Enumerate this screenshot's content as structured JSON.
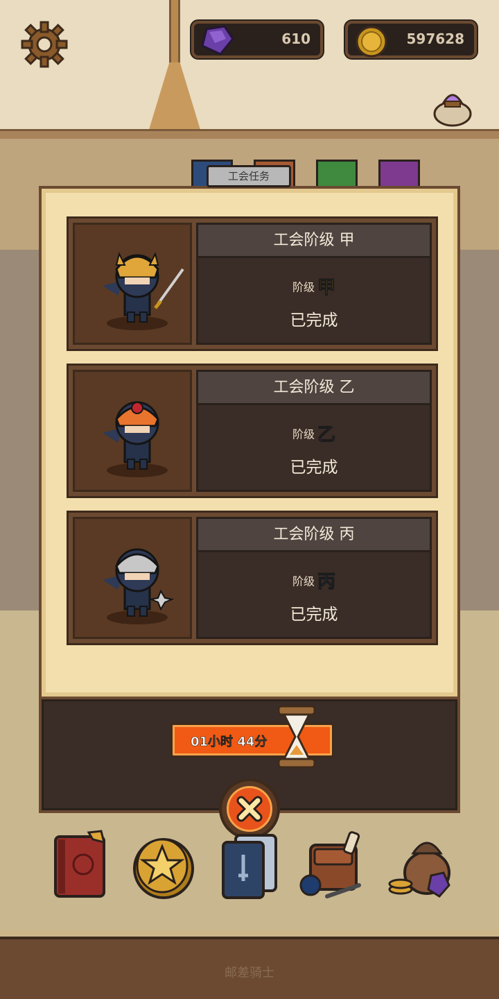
{
  "hud": {
    "gems": "610",
    "coins": "597628"
  },
  "panel": {
    "title": "工会任务"
  },
  "cards": [
    {
      "title": "工会阶级 甲",
      "rank_label": "阶级",
      "rank_glyph": "甲",
      "rank_color": "#f7c51e",
      "status": "已完成",
      "helmet": "#e0a63a"
    },
    {
      "title": "工会阶级 乙",
      "rank_label": "阶级",
      "rank_glyph": "乙",
      "rank_color": "#b04ad8",
      "status": "已完成",
      "helmet": "#e8742e"
    },
    {
      "title": "工会阶级 丙",
      "rank_label": "阶级",
      "rank_glyph": "丙",
      "rank_color": "#2f7be8",
      "status": "已完成",
      "helmet": "#c7c7c7"
    }
  ],
  "timer": {
    "text": "01小时 44分"
  },
  "dock": [
    {
      "icon": "book-icon"
    },
    {
      "icon": "star-coin-icon"
    },
    {
      "icon": "cards-icon"
    },
    {
      "icon": "backpack-icon"
    },
    {
      "icon": "treasure-bag-icon"
    }
  ],
  "footer": {
    "title": "邮差骑士"
  }
}
